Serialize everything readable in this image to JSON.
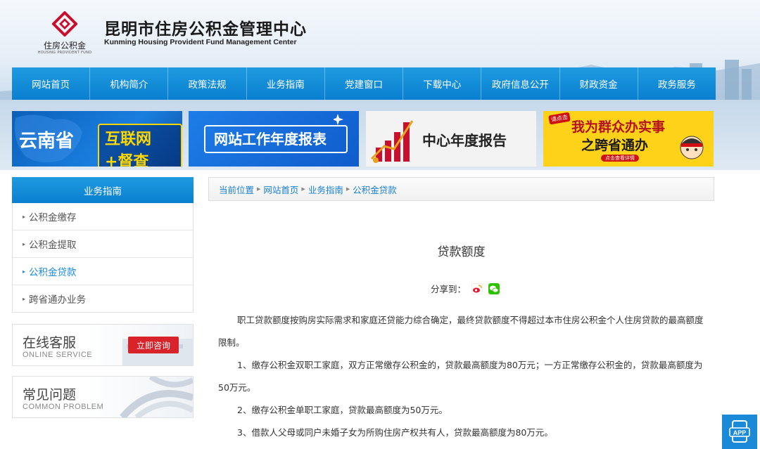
{
  "header": {
    "logo_text": "住房公积金",
    "logo_sub": "HOUSING PROVIDENT FUND",
    "title": "昆明市住房公积金管理中心",
    "subtitle": "Kunming Housing Provident Fund Management Center"
  },
  "nav": {
    "items": [
      "网站首页",
      "机构简介",
      "政策法规",
      "业务指南",
      "党建窗口",
      "下载中心",
      "政府信息公开",
      "财政资金",
      "政务服务"
    ]
  },
  "banners": {
    "b1": {
      "left": "云南省",
      "right": "互联网+督查"
    },
    "b2": {
      "text": "网站工作年度报表"
    },
    "b3": {
      "text": "中心年度报告"
    },
    "b4": {
      "tag": "请点击",
      "line1": "我为群众办实事",
      "line2": "之跨省通办",
      "note": "点击查看详情"
    }
  },
  "sidebar": {
    "title": "业务指南",
    "items": [
      "公积金缴存",
      "公积金提取",
      "公积金贷款",
      "跨省通办业务"
    ],
    "active_index": 2,
    "online": {
      "title": "在线客服",
      "sub": "ONLINE SERVICE",
      "button": "立即咨询"
    },
    "faq": {
      "title": "常见问题",
      "sub": "COMMON PROBLEM"
    }
  },
  "breadcrumb": {
    "label": "当前位置",
    "items": [
      "网站首页",
      "业务指南",
      "公积金贷款"
    ]
  },
  "article": {
    "title": "贷款额度",
    "share_label": "分享到：",
    "paragraphs": [
      "职工贷款额度按购房实际需求和家庭还贷能力综合确定，最终贷款额度不得超过本市住房公积金个人住房贷款的最高额度限制。",
      "1、缴存公积金双职工家庭，双方正常缴存公积金的，贷款最高额度为80万元；一方正常缴存公积金的，贷款最高额度为50万元。",
      "2、缴存公积金单职工家庭，贷款最高额度为50万元。",
      "3、借款人父母或同户未婚子女为所购住房产权共有人，贷款最高额度为80万元。"
    ]
  },
  "app_button": "APP",
  "colors": {
    "nav_blue": "#0a7fd0",
    "link_blue": "#1a7fd0",
    "consult_red": "#d9232a",
    "logo_red": "#c8102e"
  },
  "icons": [
    "weibo-icon",
    "wechat-icon",
    "app-icon",
    "logo-icon"
  ]
}
